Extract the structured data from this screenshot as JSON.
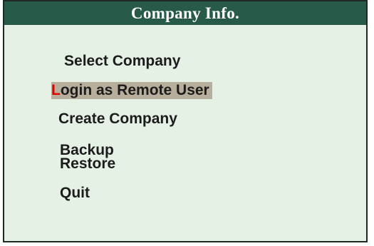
{
  "panel": {
    "title": "Company Info.",
    "items": [
      {
        "hotkey": "S",
        "rest": "elect Company",
        "selected": false
      },
      {
        "hotkey": "L",
        "rest": "ogin as Remote User",
        "selected": true
      },
      {
        "hotkey": "C",
        "rest": "reate Company",
        "selected": false
      },
      {
        "hotkey": "B",
        "rest": "ackup",
        "selected": false
      },
      {
        "hotkey": "R",
        "rest": "estore",
        "selected": false
      },
      {
        "hotkey": "Q",
        "rest": "uit",
        "selected": false
      }
    ]
  },
  "colors": {
    "title_bg": "#285a4a",
    "panel_bg": "#e4f1e4",
    "selection_bg": "#b8ae9c",
    "hotkey_selected": "#e00000"
  }
}
